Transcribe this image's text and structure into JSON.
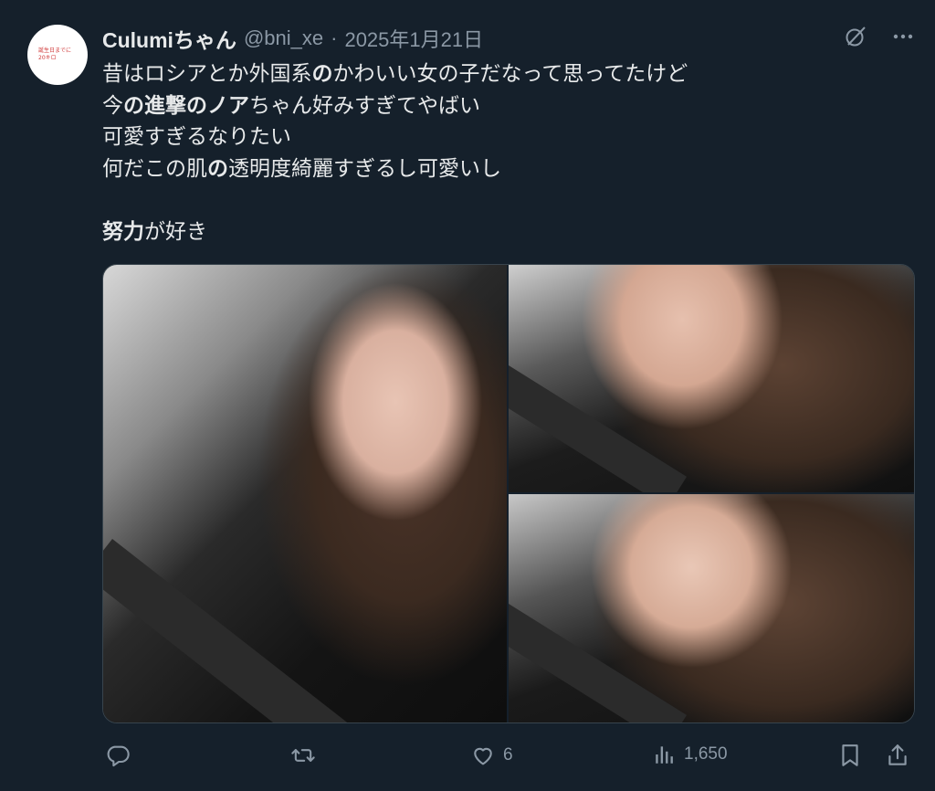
{
  "tweet": {
    "avatar_text": "誕生日までに\n20キロ",
    "display_name": "Culumiちゃん",
    "handle": "@bni_xe",
    "separator": "·",
    "date": "2025年1月21日",
    "lines": [
      [
        {
          "t": "昔はロシアとか外国系"
        },
        {
          "t": "の",
          "b": true
        },
        {
          "t": "かわいい女の子だなって思ってたけど"
        }
      ],
      [
        {
          "t": "今"
        },
        {
          "t": "の進撃のノア",
          "b": true
        },
        {
          "t": "ちゃん好みすぎてやばい"
        }
      ],
      [
        {
          "t": "可愛すぎるなりたい"
        }
      ],
      [
        {
          "t": "何だこの肌"
        },
        {
          "t": "の",
          "b": true
        },
        {
          "t": "透明度綺麗すぎるし可愛いし"
        }
      ],
      [],
      [
        {
          "t": "努力",
          "b": true
        },
        {
          "t": "が好き"
        }
      ]
    ]
  },
  "icons": {
    "grok": "grok-icon",
    "more": "more-icon",
    "reply": "reply-icon",
    "retweet": "retweet-icon",
    "like": "like-icon",
    "views": "views-icon",
    "bookmark": "bookmark-icon",
    "share": "share-icon"
  },
  "actions": {
    "reply_count": "",
    "retweet_count": "",
    "like_count": "6",
    "view_count": "1,650"
  },
  "colors": {
    "background": "#15202b",
    "text": "#e7e9ea",
    "secondary": "#8b98a5",
    "border": "#38444d"
  }
}
